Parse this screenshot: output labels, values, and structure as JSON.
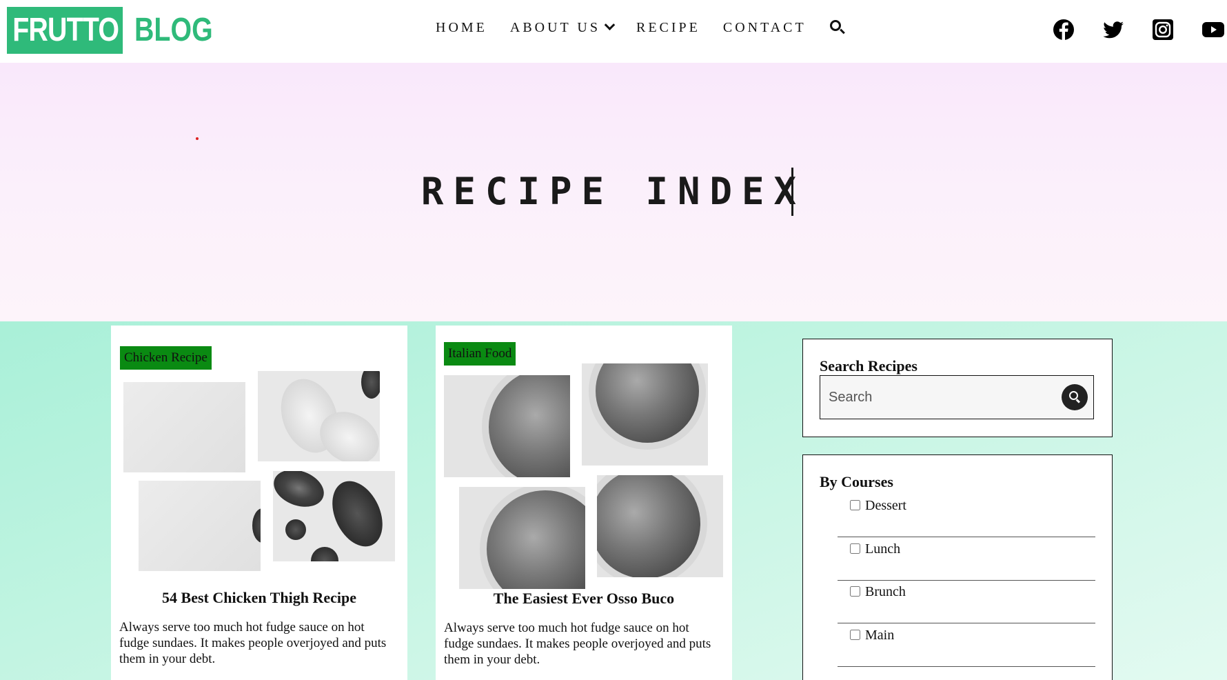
{
  "brand": {
    "logo_main": "FRUTTO",
    "logo_secondary": "BLOG",
    "accent_color": "#2fba7a"
  },
  "nav": {
    "items": [
      {
        "label": "HOME"
      },
      {
        "label": "ABOUT US"
      },
      {
        "label": "RECIPE"
      },
      {
        "label": "CONTACT"
      }
    ]
  },
  "social": [
    "facebook-icon",
    "twitter-icon",
    "instagram-icon",
    "youtube-icon"
  ],
  "hero": {
    "title": "RECIPE INDEX"
  },
  "cards": [
    {
      "tag": "Chicken Recipe",
      "title": "54 Best Chicken Thigh Recipe",
      "text": "Always serve too much hot fudge sauce on hot fudge sundaes. It makes people overjoyed and puts them in your debt."
    },
    {
      "tag": "Italian Food",
      "title": "The Easiest Ever Osso Buco",
      "text": "Always serve too much hot fudge sauce on hot fudge sundaes. It makes people overjoyed and puts them in your debt."
    }
  ],
  "sidebar": {
    "search": {
      "title": "Search Recipes",
      "placeholder": "Search"
    },
    "courses": {
      "title": "By Courses",
      "items": [
        {
          "label": "Dessert"
        },
        {
          "label": "Lunch"
        },
        {
          "label": "Brunch"
        },
        {
          "label": "Main"
        }
      ]
    }
  },
  "colors": {
    "tag_bg": "#0a8a12",
    "hero_bg": "#f9e8fb",
    "content_bg": "#a9f0d8"
  }
}
